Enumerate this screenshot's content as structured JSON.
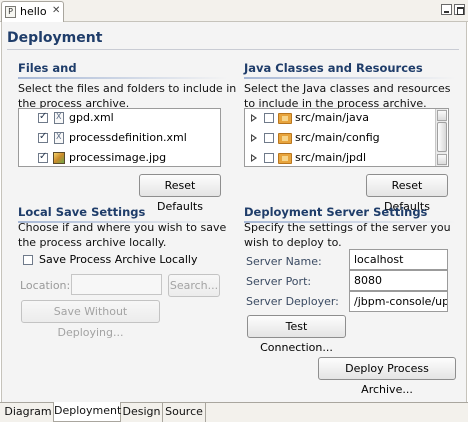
{
  "editor_tab": {
    "label": "hello",
    "file_icon_letter": "P"
  },
  "page_title": "Deployment",
  "files_section": {
    "title": "Files and",
    "description_line1": "Select the files and folders to include in",
    "description_line2": "the process archive.",
    "items": [
      {
        "label": "gpd.xml",
        "checked": true,
        "icon": "xml-file-icon"
      },
      {
        "label": "processdefinition.xml",
        "checked": true,
        "icon": "xml-file-icon"
      },
      {
        "label": "processimage.jpg",
        "checked": true,
        "icon": "image-file-icon"
      }
    ],
    "reset_label": "Reset Defaults"
  },
  "classes_section": {
    "title": "Java Classes and Resources",
    "description_line1": "Select the Java classes and resources",
    "description_line2": "to include in the process archive.",
    "items": [
      {
        "label": "src/main/java",
        "checked": false,
        "icon": "package-folder-icon"
      },
      {
        "label": "src/main/config",
        "checked": false,
        "icon": "package-folder-icon"
      },
      {
        "label": "src/main/jpdl",
        "checked": false,
        "icon": "package-folder-icon"
      }
    ],
    "reset_label": "Reset Defaults"
  },
  "local_save": {
    "title": "Local Save Settings",
    "description_line1": "Choose if and where you wish to save",
    "description_line2": "the process archive locally.",
    "checkbox_label": "Save Process Archive Locally",
    "checkbox_checked": false,
    "location_label": "Location:",
    "location_value": "",
    "search_label": "Search...",
    "save_without_deploying_label": "Save Without Deploying..."
  },
  "server_settings": {
    "title": "Deployment Server Settings",
    "description_line1": "Specify the settings of the server you",
    "description_line2": "wish to deploy to.",
    "server_name_label": "Server Name:",
    "server_name_value": "localhost",
    "server_port_label": "Server Port:",
    "server_port_value": "8080",
    "server_deployer_label": "Server Deployer:",
    "server_deployer_value": "/jbpm-console/uplo",
    "test_connection_label": "Test Connection..."
  },
  "deploy_label": "Deploy Process Archive...",
  "page_tabs": [
    {
      "label": "Diagram",
      "active": false
    },
    {
      "label": "Deployment",
      "active": true
    },
    {
      "label": "Design",
      "active": false
    },
    {
      "label": "Source",
      "active": false
    }
  ],
  "colors": {
    "section_title": "#1f3d6a",
    "form_background": "#f4f4f4"
  }
}
